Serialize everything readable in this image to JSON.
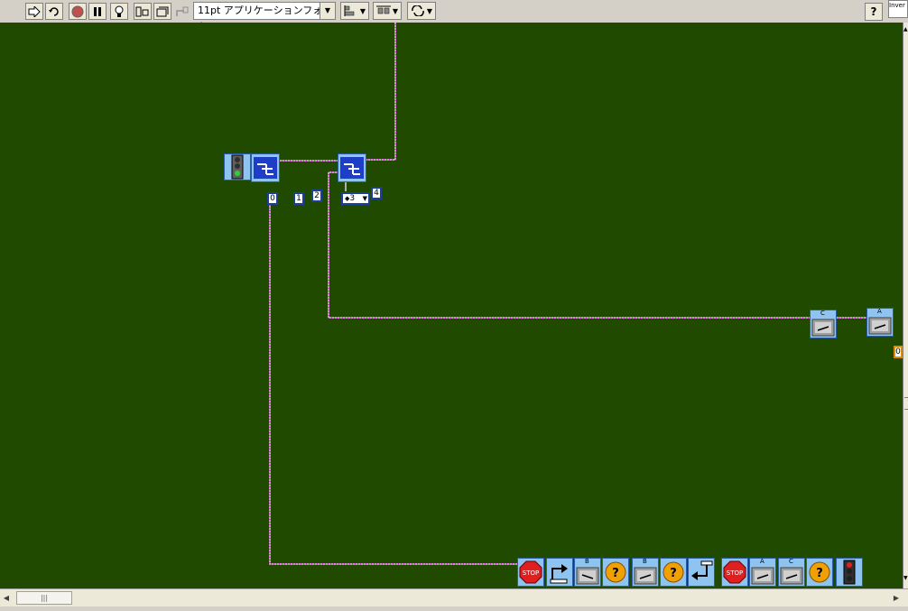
{
  "toolbar": {
    "run_icon": "run-arrow-icon",
    "run_continuous_icon": "run-continuous-icon",
    "abort_icon": "abort-icon",
    "pause_icon": "pause-icon",
    "highlight_icon": "highlight-execution-icon",
    "retain_wire_icon": "retain-wire-values-icon",
    "step_icon": "step-icon",
    "step_out_icon": "step-out-icon",
    "font_label": "11pt アプリケーションフォント",
    "align_icon": "align-objects-icon",
    "distribute_icon": "distribute-objects-icon",
    "reorder_icon": "reorder-icon",
    "help_label": "?",
    "context_text": "Inver"
  },
  "diagram": {
    "constants": [
      "0",
      "1",
      "2",
      "4"
    ],
    "ring_value": "3",
    "ring_prefix": "◆",
    "motor_labels": [
      "C",
      "A",
      "B",
      "B",
      "A",
      "C"
    ],
    "orange_const": "0",
    "stop_text": "STOP",
    "question_mark": "?"
  },
  "colors": {
    "canvas": "#1f4a00",
    "wire": "#e040e0",
    "block_blue": "#8fc4f0",
    "timer_block": "#1e3ec8"
  },
  "scrollbar": {
    "thumb_grip": "|||"
  }
}
